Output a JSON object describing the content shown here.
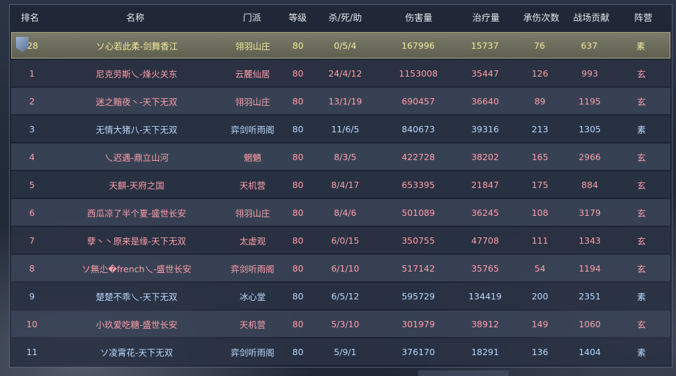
{
  "header": {
    "rank": "排名",
    "name": "名称",
    "faction": "门派",
    "level": "等级",
    "kda": "杀/死/助",
    "damage": "伤害量",
    "heal": "治疗量",
    "hits_taken": "承伤次数",
    "contribution": "战场贡献",
    "camp": "阵营"
  },
  "rows": [
    {
      "rank": "28",
      "name": "ソ心若此柔-剑舞香江",
      "faction": "翎羽山庄",
      "level": "80",
      "kda": "0/5/4",
      "damage": "167996",
      "heal": "15737",
      "hits_taken": "76",
      "contribution": "637",
      "camp": "素"
    },
    {
      "rank": "1",
      "name": "尼克劳斯乀-烽火关东",
      "faction": "云麓仙居",
      "level": "80",
      "kda": "24/4/12",
      "damage": "1153008",
      "heal": "35447",
      "hits_taken": "126",
      "contribution": "993",
      "camp": "玄"
    },
    {
      "rank": "2",
      "name": "迷之黯夜丶-天下无双",
      "faction": "翎羽山庄",
      "level": "80",
      "kda": "13/1/19",
      "damage": "690457",
      "heal": "36640",
      "hits_taken": "89",
      "contribution": "1195",
      "camp": "玄"
    },
    {
      "rank": "3",
      "name": "无情大猪八-天下无双",
      "faction": "弈剑听雨阁",
      "level": "80",
      "kda": "11/6/5",
      "damage": "840673",
      "heal": "39316",
      "hits_taken": "213",
      "contribution": "1305",
      "camp": "素"
    },
    {
      "rank": "4",
      "name": "乀迟遇-鼎立山河",
      "faction": "魍魉",
      "level": "80",
      "kda": "8/3/5",
      "damage": "422728",
      "heal": "38202",
      "hits_taken": "165",
      "contribution": "2966",
      "camp": "玄"
    },
    {
      "rank": "5",
      "name": "天麒-天府之国",
      "faction": "天机营",
      "level": "80",
      "kda": "8/4/17",
      "damage": "653395",
      "heal": "21847",
      "hits_taken": "175",
      "contribution": "884",
      "camp": "玄"
    },
    {
      "rank": "6",
      "name": "西瓜凉了半个夏-盛世长安",
      "faction": "翎羽山庄",
      "level": "80",
      "kda": "8/4/6",
      "damage": "501089",
      "heal": "36245",
      "hits_taken": "108",
      "contribution": "3179",
      "camp": "玄"
    },
    {
      "rank": "7",
      "name": "孽丶丶原来是缘-天下无双",
      "faction": "太虚观",
      "level": "80",
      "kda": "6/0/15",
      "damage": "350755",
      "heal": "47708",
      "hits_taken": "111",
      "contribution": "1343",
      "camp": "玄"
    },
    {
      "rank": "8",
      "name": "ソ無尐�french乀-盛世长安",
      "faction": "弈剑听雨阁",
      "level": "80",
      "kda": "6/1/10",
      "damage": "517142",
      "heal": "35765",
      "hits_taken": "54",
      "contribution": "1194",
      "camp": "玄"
    },
    {
      "rank": "9",
      "name": "楚楚不乖乀-天下无双",
      "faction": "冰心堂",
      "level": "80",
      "kda": "6/5/12",
      "damage": "595729",
      "heal": "134419",
      "hits_taken": "200",
      "contribution": "2351",
      "camp": "素"
    },
    {
      "rank": "10",
      "name": "小玖爱吃糖-盛世长安",
      "faction": "天机营",
      "level": "80",
      "kda": "5/3/10",
      "damage": "301979",
      "heal": "38912",
      "hits_taken": "149",
      "contribution": "1060",
      "camp": "玄"
    },
    {
      "rank": "11",
      "name": "ソ凌霄花-天下无双",
      "faction": "弈剑听雨阁",
      "level": "80",
      "kda": "5/9/1",
      "damage": "376170",
      "heal": "18291",
      "hits_taken": "136",
      "contribution": "1404",
      "camp": "素"
    }
  ],
  "colors": {
    "camp_xuan": "#ff9fa8",
    "camp_su": "#b9d8ff",
    "self_row": "#f3ea9a"
  }
}
